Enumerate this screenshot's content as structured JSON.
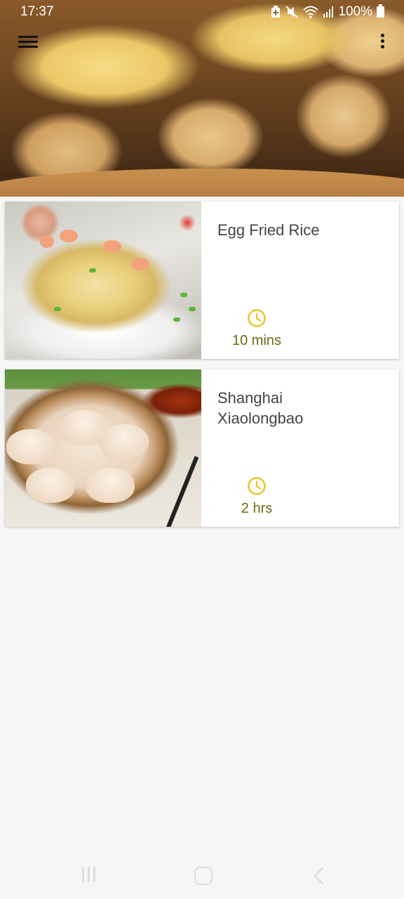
{
  "status_bar": {
    "time": "17:37",
    "battery": "100%",
    "icons": [
      "battery-saver-icon",
      "mute-icon",
      "wifi-icon",
      "signal-icon",
      "battery-icon"
    ]
  },
  "toolbar": {
    "menu_icon": "hamburger-menu-icon",
    "overflow_icon": "more-vert-icon"
  },
  "recipes": [
    {
      "name": "Egg Fried Rice",
      "duration": "10 mins",
      "icon": "clock-icon"
    },
    {
      "name": "Shanghai\nXiaolongbao",
      "duration": "2 hrs",
      "icon": "clock-icon"
    }
  ],
  "colors": {
    "accent_clock": "#e9c52a",
    "duration_text": "#6f6a16",
    "title_text": "#444444",
    "background": "#f6f6f6"
  },
  "nav_bar": {
    "buttons": [
      "recents-icon",
      "home-icon",
      "back-icon"
    ]
  }
}
